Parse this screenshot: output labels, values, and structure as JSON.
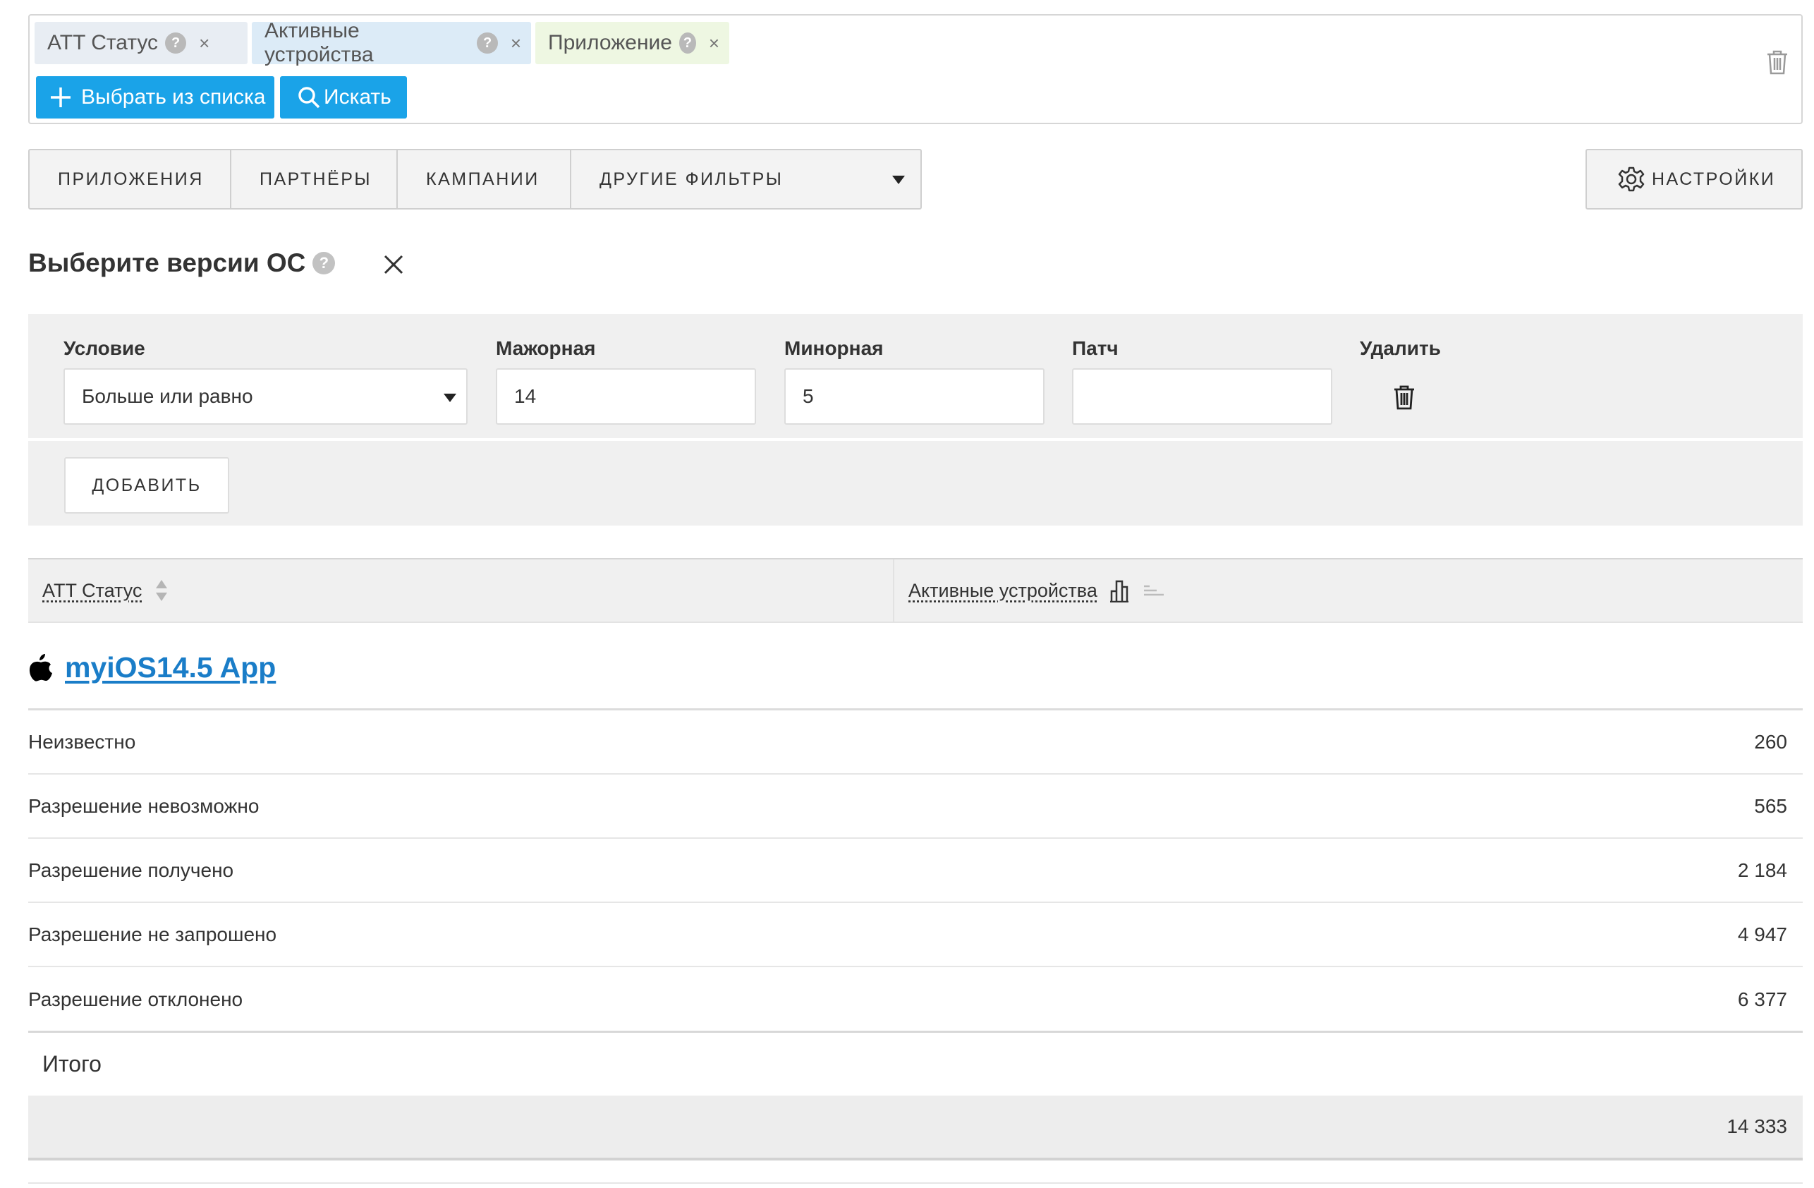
{
  "filters": {
    "chips": [
      {
        "label": "ATT Статус",
        "help": "?",
        "remove": "×",
        "bg": "#e8edf3"
      },
      {
        "label": "Активные устройства",
        "help": "?",
        "remove": "×",
        "bg": "#dcebf7"
      },
      {
        "label": "Приложение",
        "help": "?",
        "remove": "×",
        "bg": "#eef7e2"
      }
    ],
    "select_button": "Выбрать из списка",
    "search_button": "Искать",
    "accent_color": "#1aa3e8"
  },
  "tabs": [
    "ПРИЛОЖЕНИЯ",
    "ПАРТНЁРЫ",
    "КАМПАНИИ",
    "ДРУГИЕ ФИЛЬТРЫ"
  ],
  "settings_label": "НАСТРОЙКИ",
  "os_filter": {
    "title": "Выберите версии ОС",
    "help": "?",
    "columns": {
      "condition": "Условие",
      "major": "Мажорная",
      "minor": "Минорная",
      "patch": "Патч",
      "delete": "Удалить"
    },
    "condition_value": "Больше или равно",
    "major_value": "14",
    "minor_value": "5",
    "patch_value": "",
    "add_button": "ДОБАВИТЬ"
  },
  "table": {
    "headers": {
      "status": "ATT Статус",
      "devices": "Активные устройства"
    },
    "app_name": "myiOS14.5 App",
    "link_color": "#1a7dc8",
    "rows": [
      {
        "name": "Неизвестно",
        "value": "260"
      },
      {
        "name": "Разрешение невозможно",
        "value": "565"
      },
      {
        "name": "Разрешение получено",
        "value": "2 184"
      },
      {
        "name": "Разрешение не запрошено",
        "value": "4 947"
      },
      {
        "name": "Разрешение отклонено",
        "value": "6 377"
      }
    ],
    "total_label": "Итого",
    "total_value": "14 333"
  }
}
